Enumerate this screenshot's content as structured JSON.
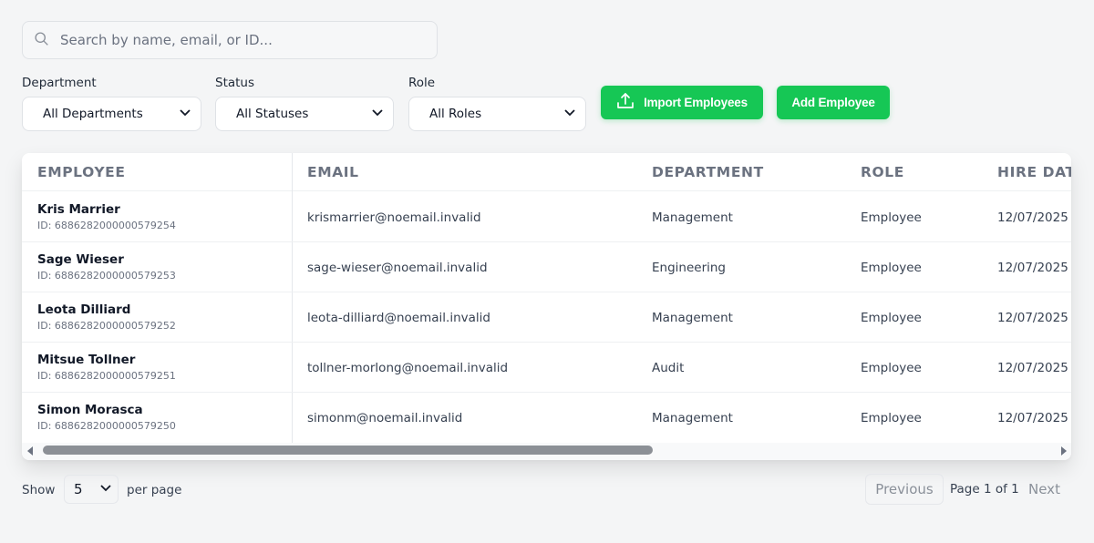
{
  "search": {
    "placeholder": "Search by name, email, or ID..."
  },
  "filters": [
    {
      "label": "Department",
      "value": "All Departments"
    },
    {
      "label": "Status",
      "value": "All Statuses"
    },
    {
      "label": "Role",
      "value": "All Roles"
    }
  ],
  "buttons": {
    "import": "Import Employees",
    "add": "Add Employee",
    "accent": "#16c755"
  },
  "table": {
    "headers": [
      "EMPLOYEE",
      "EMAIL",
      "DEPARTMENT",
      "ROLE",
      "HIRE DATE"
    ],
    "rows": [
      {
        "name": "Kris Marrier",
        "id": "ID: 6886282000000579254",
        "email": "krismarrier@noemail.invalid",
        "department": "Management",
        "role": "Employee",
        "hire_date": "12/07/2025"
      },
      {
        "name": "Sage Wieser",
        "id": "ID: 6886282000000579253",
        "email": "sage-wieser@noemail.invalid",
        "department": "Engineering",
        "role": "Employee",
        "hire_date": "12/07/2025"
      },
      {
        "name": "Leota Dilliard",
        "id": "ID: 6886282000000579252",
        "email": "leota-dilliard@noemail.invalid",
        "department": "Management",
        "role": "Employee",
        "hire_date": "12/07/2025"
      },
      {
        "name": "Mitsue Tollner",
        "id": "ID: 6886282000000579251",
        "email": "tollner-morlong@noemail.invalid",
        "department": "Audit",
        "role": "Employee",
        "hire_date": "12/07/2025"
      },
      {
        "name": "Simon Morasca",
        "id": "ID: 6886282000000579250",
        "email": "simonm@noemail.invalid",
        "department": "Management",
        "role": "Employee",
        "hire_date": "12/07/2025"
      }
    ]
  },
  "footer": {
    "show": "Show",
    "per_page_value": "5",
    "per_page": "per page",
    "previous": "Previous",
    "page_info": "Page 1 of 1",
    "next": "Next"
  }
}
